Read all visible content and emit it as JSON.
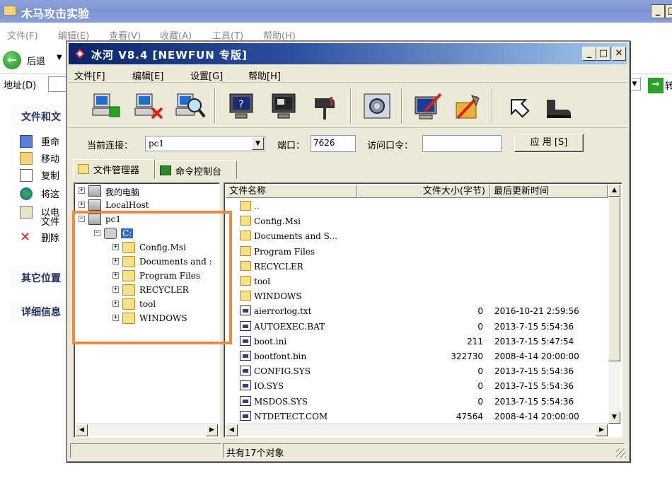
{
  "background_window": {
    "title": "木马攻击实验",
    "menu": [
      "文件(F)",
      "编辑(E)",
      "查看(V)",
      "收藏(A)",
      "工具(T)",
      "帮助(H)"
    ],
    "back_label": "后退",
    "address_label": "地址(D)",
    "go_label": "转",
    "task_sections": [
      "文件和文",
      "其它位置",
      "详细信息"
    ],
    "task_items": [
      {
        "label": "重命",
        "label2": ""
      },
      {
        "label": "移动",
        "label2": ""
      },
      {
        "label": "复制",
        "label2": ""
      },
      {
        "label": "将这",
        "label2": ""
      },
      {
        "label": "以电",
        "label2": "文件"
      },
      {
        "label": "删除",
        "label2": ""
      }
    ]
  },
  "main_window": {
    "title": "冰河 V8.4 [NEWFUN 专版]",
    "menu": [
      "文件[F]",
      "编辑[E]",
      "设置[G]",
      "帮助[H]"
    ],
    "toolbar_icons": [
      "add-host-icon",
      "delete-host-icon",
      "search-host-icon",
      "help-screen-icon",
      "screen-control-icon",
      "mailbox-icon",
      "settings-gear-icon",
      "pen-monitor-icon",
      "tools-icon",
      "back-arrow-icon",
      "boot-icon"
    ],
    "connection": {
      "current_label": "当前连接：",
      "current_value": "pc1",
      "port_label": "端口：",
      "port_value": "7626",
      "password_label": "访问口令：",
      "password_value": "",
      "apply_label": "应 用 [S]"
    },
    "tabs": [
      "文件管理器",
      "命令控制台"
    ],
    "tree": {
      "nodes": [
        {
          "label": "我的电脑",
          "sign": "+"
        },
        {
          "label": "LocalHost",
          "sign": "+"
        },
        {
          "label": "pc1",
          "sign": "−"
        },
        {
          "label": "C:",
          "sign": "−"
        },
        {
          "label": "Config.Msi",
          "sign": "+"
        },
        {
          "label": "Documents and :",
          "sign": "+"
        },
        {
          "label": "Program Files",
          "sign": "+"
        },
        {
          "label": "RECYCLER",
          "sign": "+"
        },
        {
          "label": "tool",
          "sign": "+"
        },
        {
          "label": "WINDOWS",
          "sign": "+"
        }
      ]
    },
    "file_list": {
      "headers": [
        "文件名称",
        "文件大小(字节)",
        "最后更新时间"
      ],
      "rows": [
        {
          "type": "folder",
          "name": "..",
          "size": "",
          "date": ""
        },
        {
          "type": "folder",
          "name": "Config.Msi",
          "size": "",
          "date": ""
        },
        {
          "type": "folder",
          "name": "Documents and S...",
          "size": "",
          "date": ""
        },
        {
          "type": "folder",
          "name": "Program Files",
          "size": "",
          "date": ""
        },
        {
          "type": "folder",
          "name": "RECYCLER",
          "size": "",
          "date": ""
        },
        {
          "type": "folder",
          "name": "tool",
          "size": "",
          "date": ""
        },
        {
          "type": "folder",
          "name": "WINDOWS",
          "size": "",
          "date": ""
        },
        {
          "type": "file",
          "name": "aierrorlog.txt",
          "size": "0",
          "date": "2016-10-21 2:59:56"
        },
        {
          "type": "file",
          "name": "AUTOEXEC.BAT",
          "size": "0",
          "date": "2013-7-15 5:54:36"
        },
        {
          "type": "file",
          "name": "boot.ini",
          "size": "211",
          "date": "2013-7-15 5:47:54"
        },
        {
          "type": "file",
          "name": "bootfont.bin",
          "size": "322730",
          "date": "2008-4-14 20:00:00"
        },
        {
          "type": "file",
          "name": "CONFIG.SYS",
          "size": "0",
          "date": "2013-7-15 5:54:36"
        },
        {
          "type": "file",
          "name": "IO.SYS",
          "size": "0",
          "date": "2013-7-15 5:54:36"
        },
        {
          "type": "file",
          "name": "MSDOS.SYS",
          "size": "0",
          "date": "2013-7-15 5:54:36"
        },
        {
          "type": "file",
          "name": "NTDETECT.COM",
          "size": "47564",
          "date": "2008-4-14 20:00:00"
        }
      ]
    },
    "status": "共有17个对象"
  },
  "colors": {
    "highlight_box": "#f08a3c",
    "title_gradient_start": "#0a246a",
    "title_gradient_end": "#a6caf0"
  }
}
